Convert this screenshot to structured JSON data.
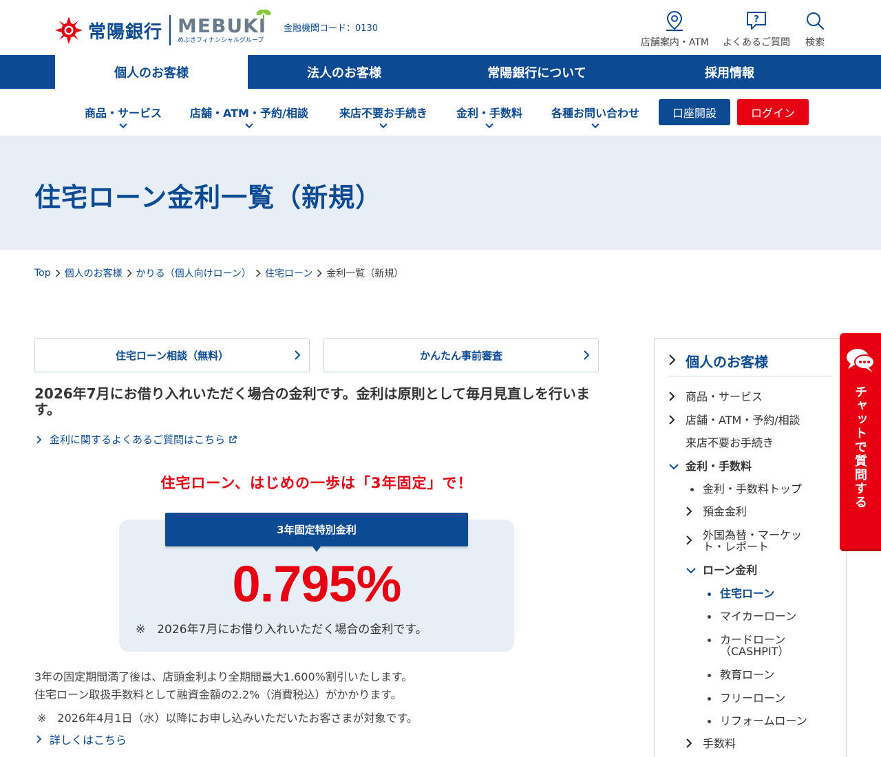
{
  "header": {
    "logo_name": "常陽銀行",
    "group_logo": "MEBUKI",
    "group_sub": "めぶきフィナンシャルグループ",
    "bank_code": "金融機関コード：0130",
    "util": [
      {
        "label": "店舗案内・ATM",
        "icon": "map-pin-icon"
      },
      {
        "label": "よくあるご質問",
        "icon": "question-bubble-icon"
      },
      {
        "label": "検索",
        "icon": "search-icon"
      }
    ]
  },
  "global_nav": [
    "個人のお客様",
    "法人のお客様",
    "常陽銀行について",
    "採用情報"
  ],
  "sub_nav": {
    "items": [
      "商品・サービス",
      "店舗・ATM・予約/相談",
      "来店不要お手続き",
      "金利・手数料",
      "各種お問い合わせ"
    ],
    "open_account": "口座開設",
    "login": "ログイン"
  },
  "page_title": "住宅ローン金利一覧（新規）",
  "breadcrumb": [
    "Top",
    "個人のお客様",
    "かりる（個人向けローン）",
    "住宅ローン",
    "金利一覧（新規）"
  ],
  "buttons": {
    "consult": "住宅ローン相談（無料）",
    "precheck": "かんたん事前審査"
  },
  "lead": "2026年7月にお借り入れいただく場合の金利です。金利は原則として毎月見直しを行います。",
  "faq_link": "金利に関するよくあるご質問はこちら",
  "promo": {
    "headline": "住宅ローン、はじめの一歩は「3年固定」で！",
    "badge": "3年固定特別金利",
    "rate": "0.795%",
    "note": "※　2026年7月にお借り入れいただく場合の金利です。"
  },
  "para1": "3年の固定期間満了後は、店頭金利より全期間最大1.600%割引いたします。",
  "para2": "住宅ローン取扱手数料として融資金額の2.2%（消費税込）がかかります。",
  "para3": "※　2026年4月1日（水）以降にお申し込みいただいたお客さまが対象です。",
  "detail_link": "詳しくはこちら",
  "side_nav": {
    "head": "個人のお客様",
    "items": [
      "商品・サービス",
      "店舗・ATM・予約/相談",
      "来店不要お手続き",
      "金利・手数料",
      "金利・手数料トップ",
      "預金金利",
      "外国為替・マーケット・レポート",
      "ローン金利",
      "住宅ローン",
      "マイカーローン",
      "カードローン（CASHPIT）",
      "教育ローン",
      "フリーローン",
      "リフォームローン",
      "手数料"
    ]
  },
  "chat": "チャットで質問する",
  "colors": {
    "brand": "#0c4a93",
    "accent": "#e60012",
    "band": "#e8eef6"
  }
}
